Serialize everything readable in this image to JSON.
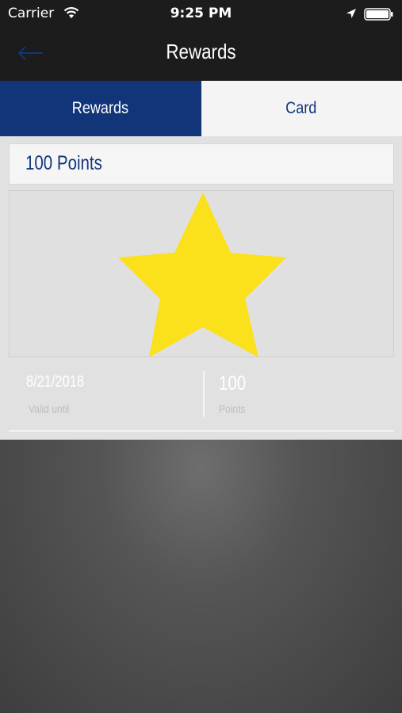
{
  "status_bar": {
    "carrier": "Carrier",
    "time": "9:25 PM",
    "icons": [
      "wifi-icon",
      "location-arrow-icon",
      "battery-icon"
    ]
  },
  "nav": {
    "title": "Rewards",
    "back_icon": "back-arrow-icon"
  },
  "tabs": [
    {
      "label": "Rewards",
      "active": true
    },
    {
      "label": "Card",
      "active": false
    }
  ],
  "reward": {
    "title": "100 Points",
    "image_icon": "star-icon",
    "valid_until_value": "8/21/2018",
    "valid_until_label": "Valid until",
    "points_value": "100",
    "points_label": "Points"
  },
  "colors": {
    "brand_blue": "#12357a",
    "star_yellow": "#fbe01c",
    "status_bar_bg": "#1c1c1c"
  }
}
